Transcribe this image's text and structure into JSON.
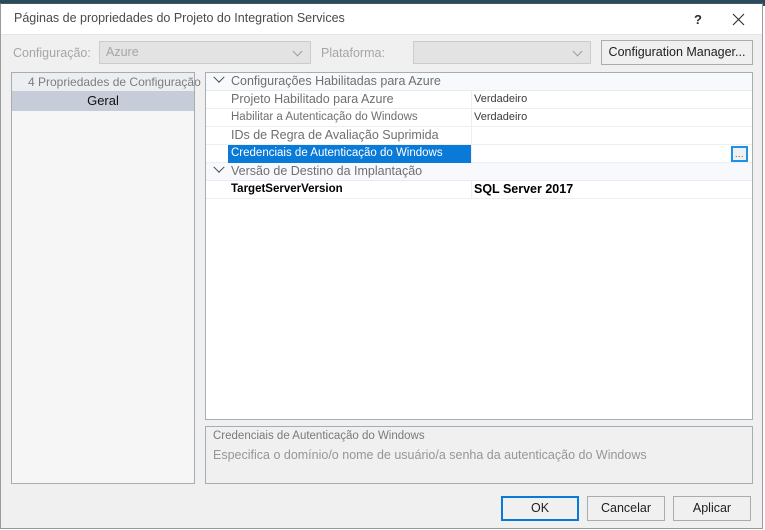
{
  "window": {
    "title": "Páginas de propriedades do Projeto do Integration Services",
    "help_icon": "?",
    "help_icon_name": "help-icon",
    "close_icon_name": "close-icon"
  },
  "config_bar": {
    "config_label": "Configuração:",
    "config_value": "Azure",
    "platform_label": "Plataforma:",
    "platform_value": "",
    "config_manager_button": "Configuration Manager..."
  },
  "tree": {
    "header": "4 Propriedades de Configuração",
    "header_glyph": "",
    "items": [
      {
        "label": "Geral",
        "selected": true
      }
    ]
  },
  "grid": {
    "rows": [
      {
        "kind": "category",
        "name": "Configurações Habilitadas para Azure",
        "value": "",
        "expanded": true
      },
      {
        "kind": "property",
        "name": "Projeto Habilitado para Azure",
        "value": "Verdadeiro",
        "style": "normal"
      },
      {
        "kind": "property",
        "name": "Habilitar a Autenticação do Windows",
        "value": "Verdadeiro",
        "style": "small"
      },
      {
        "kind": "property",
        "name": "IDs de Regra de Avaliação Suprimida",
        "value": "",
        "style": "normal"
      },
      {
        "kind": "property",
        "name": "Credenciais de Autenticação do Windows",
        "value": "",
        "style": "small",
        "selected": true,
        "has_ellipsis": true,
        "ellipsis_label": "..."
      },
      {
        "kind": "category",
        "name": "Versão de Destino da Implantação",
        "value": "",
        "expanded": true
      },
      {
        "kind": "property",
        "name": "TargetServerVersion",
        "value": "SQL Server 2017",
        "style": "boldblack"
      }
    ]
  },
  "description": {
    "title": "Credenciais de Autenticação do Windows",
    "text": "Especifica o domínio/o nome de usuário/a senha da autenticação do Windows"
  },
  "footer": {
    "ok": "OK",
    "cancel": "Cancelar",
    "apply": "Aplicar"
  },
  "colors": {
    "selection_blue": "#0a7ad8",
    "focus_blue": "#1e92e8",
    "dialog_bg": "#f0f0f0",
    "title_text": "#4a4a4a",
    "desktop_strip": "#2d4a5c"
  }
}
